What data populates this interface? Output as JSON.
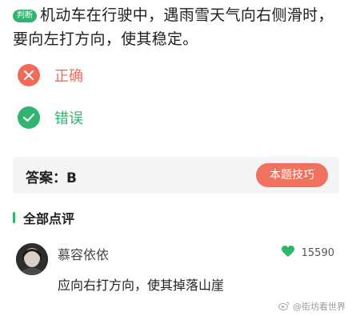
{
  "question": {
    "badge": "判断",
    "text": "机动车在行驶中，遇雨雪天气向右侧滑时，要向左打方向，使其稳定。"
  },
  "options": [
    {
      "label": "正确",
      "state": "wrong",
      "icon": "close-icon",
      "color": "#f06a5a"
    },
    {
      "label": "错误",
      "state": "correct",
      "icon": "check-icon",
      "color": "#2fb56e"
    }
  ],
  "answer": {
    "text": "答案：B",
    "tip_button": "本题技巧"
  },
  "comments": {
    "section_title": "全部点评",
    "items": [
      {
        "username": "慕容依依",
        "likes": "15590",
        "text": "应向右打方向，使其掉落山崖"
      }
    ]
  },
  "watermark": "@街坊看世界",
  "colors": {
    "accent_green": "#2fb56e",
    "accent_red": "#f06a5a"
  }
}
